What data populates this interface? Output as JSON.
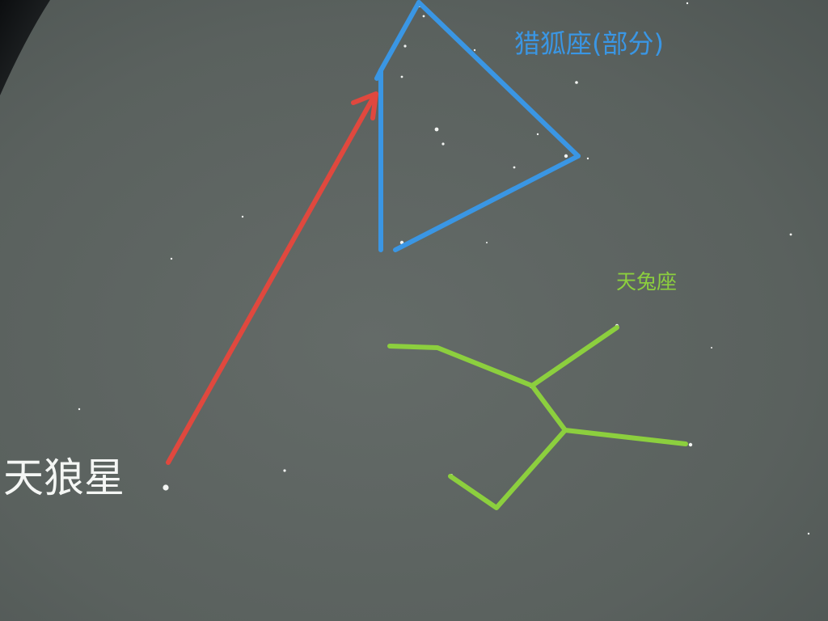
{
  "labels": {
    "sirius": "天狼星",
    "orion": "猎狐座(部分)",
    "lepus": "天兔座"
  },
  "colors": {
    "sky": "#5b625f",
    "sky_dark_corner": "#111315",
    "star": "#f2f4f2",
    "pointer_arrow": "#e0483e",
    "orion_lines": "#3a96e4",
    "lepus_lines": "#8ccf3e",
    "sirius_label": "#f4f6f4"
  },
  "icons": {
    "pointer": "arrow-icon"
  }
}
